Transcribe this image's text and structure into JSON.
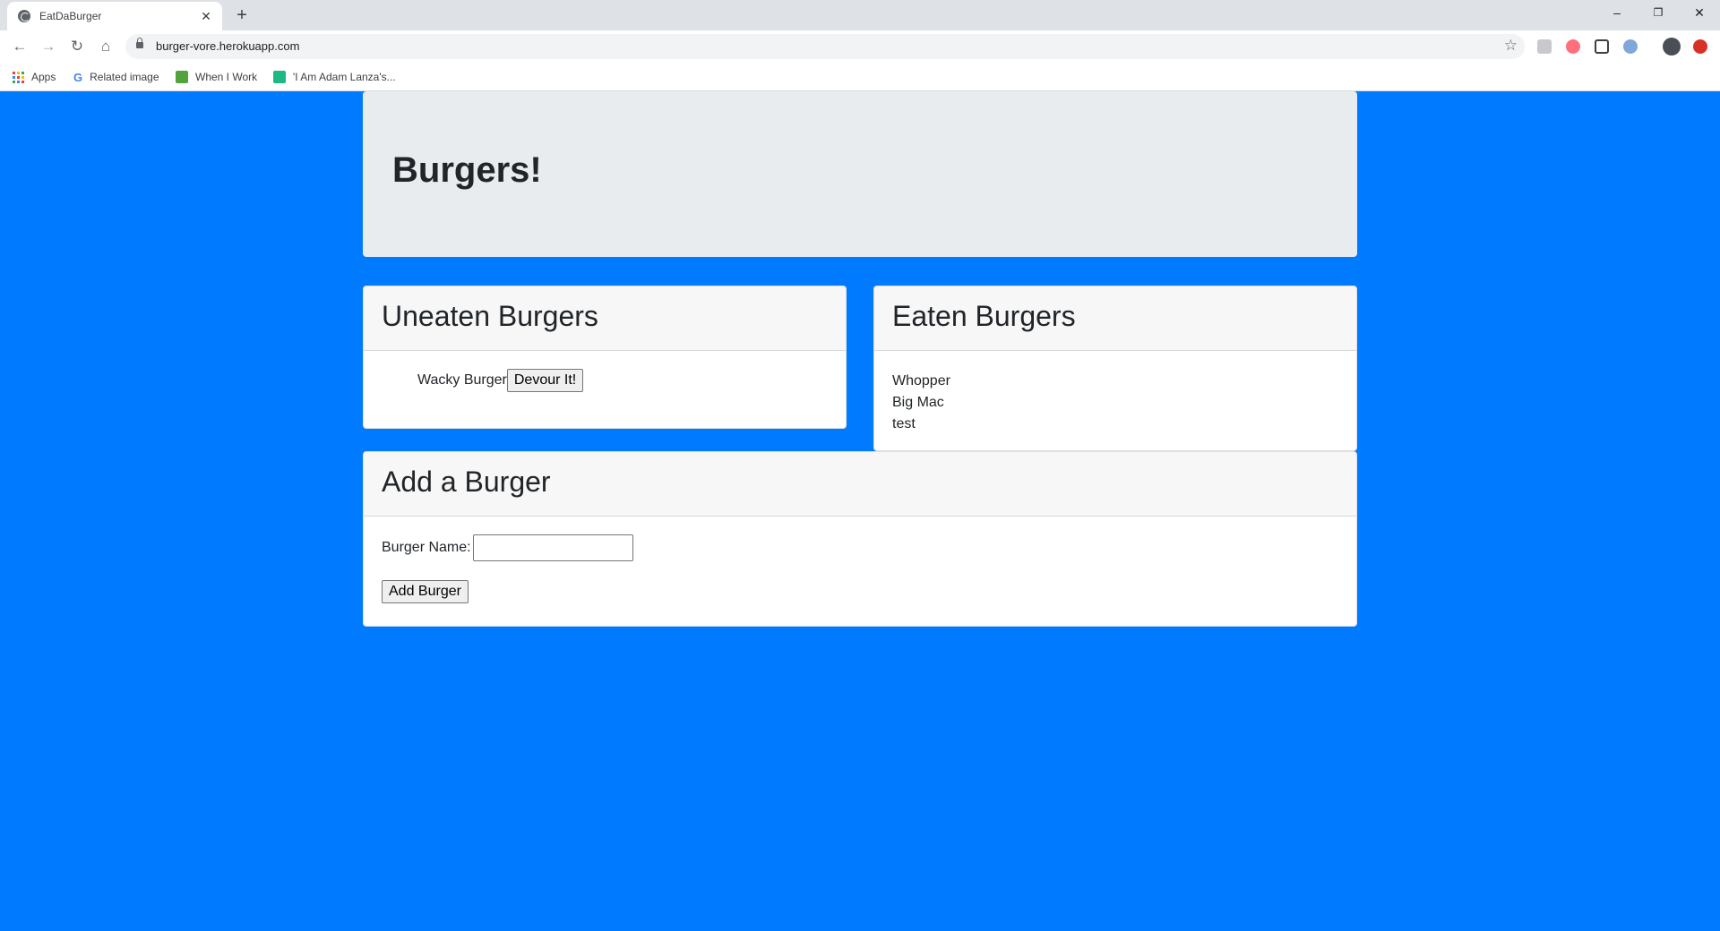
{
  "browser": {
    "tab_title": "EatDaBurger",
    "tab_close": "✕",
    "new_tab": "+",
    "url": "burger-vore.herokuapp.com",
    "window_controls": {
      "minimize": "–",
      "restore": "❐",
      "close": "✕"
    },
    "nav": {
      "back": "←",
      "forward": "→",
      "reload": "↻",
      "home": "⌂"
    },
    "star": "☆",
    "bookmarks": [
      {
        "label": "Apps",
        "icon": "apps-grid-icon"
      },
      {
        "label": "Related image",
        "icon": "google-icon"
      },
      {
        "label": "When I Work",
        "icon": "wheniwork-icon"
      },
      {
        "label": "'I Am Adam Lanza's...",
        "icon": "bookmark-green-icon"
      }
    ]
  },
  "page": {
    "jumbotron_title": "Burgers!",
    "uneaten": {
      "title": "Uneaten Burgers",
      "items": [
        {
          "name": "Wacky Burger",
          "action": "Devour It!"
        }
      ]
    },
    "eaten": {
      "title": "Eaten Burgers",
      "items": [
        "Whopper",
        "Big Mac",
        "test"
      ]
    },
    "add": {
      "title": "Add a Burger",
      "label": "Burger Name:",
      "input_value": "",
      "button": "Add Burger"
    }
  },
  "colors": {
    "page_background": "#007bff",
    "jumbotron": "#e9ecef"
  }
}
